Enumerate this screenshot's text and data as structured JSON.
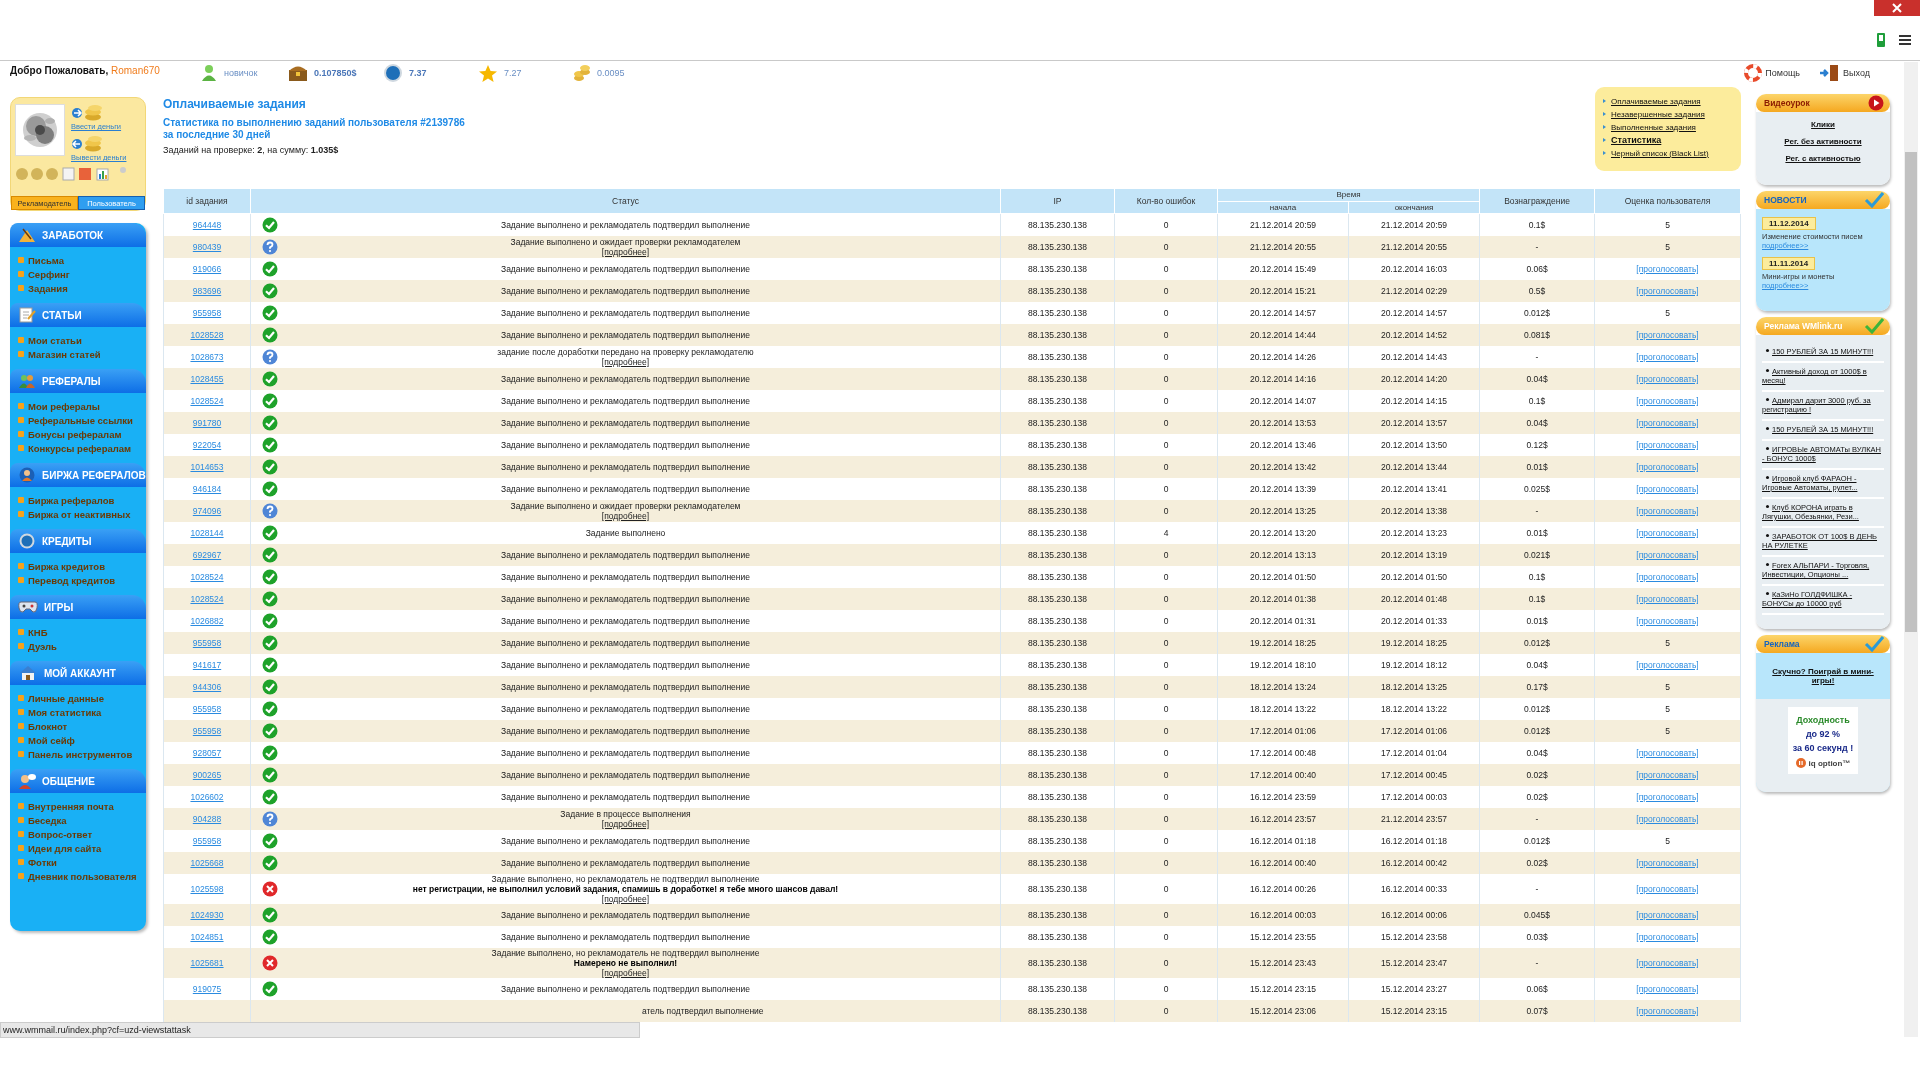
{
  "welcome": {
    "label": "Добро Пожаловать,",
    "user": "Roman670"
  },
  "stats": [
    {
      "kind": "rank",
      "value": "новичок"
    },
    {
      "kind": "balance",
      "value": "0.107850$"
    },
    {
      "kind": "credits",
      "value": "7.37"
    },
    {
      "kind": "rating",
      "value": "7.27"
    },
    {
      "kind": "coins",
      "value": "0.0095"
    }
  ],
  "profile": {
    "links": [
      "Ввести деньги",
      "Вывести деньги"
    ],
    "tabs": [
      {
        "label": "Рекламодатель",
        "selected": false
      },
      {
        "label": "Пользователь",
        "selected": true
      }
    ]
  },
  "menu": [
    {
      "kind": "earn",
      "title": "ЗАРАБОТОК",
      "items": [
        "Письма",
        "Серфинг",
        "Задания"
      ]
    },
    {
      "kind": "articles",
      "title": "СТАТЬИ",
      "items": [
        "Мои статьи",
        "Магазин статей"
      ]
    },
    {
      "kind": "referrals",
      "title": "РЕФЕРАЛЫ",
      "items": [
        "Мои рефералы",
        "Реферальные ссылки",
        "Бонусы рефералам",
        "Конкурсы рефералам"
      ]
    },
    {
      "kind": "exchange",
      "title": "БИРЖА РЕФЕРАЛОВ",
      "items": [
        "Биржа рефералов",
        "Биржа от неактивных"
      ]
    },
    {
      "kind": "credits",
      "title": "КРЕДИТЫ",
      "items": [
        "Биржа кредитов",
        "Перевод кредитов"
      ]
    },
    {
      "kind": "games",
      "title": "ИГРЫ",
      "items": [
        "КНБ",
        "Дуэль"
      ]
    },
    {
      "kind": "account",
      "title": "МОЙ АККАУНТ",
      "items": [
        "Личные данные",
        "Моя статистика",
        "Блокнот",
        "Мой сейф",
        "Панель инструментов"
      ]
    },
    {
      "kind": "chat",
      "title": "ОБЩЕНИЕ",
      "items": [
        "Внутренняя почта",
        "Беседка",
        "Вопрос-ответ",
        "Идеи для сайта",
        "Фотки",
        "Дневник пользователя"
      ]
    }
  ],
  "page": {
    "title": "Оплачиваемые задания",
    "subtitle": [
      "Статистика по выполнению заданий пользователя #2139786",
      "за последние 30 дней"
    ],
    "summary": "Заданий на проверке: **2**, на сумму: **1.035$**"
  },
  "nav": [
    {
      "label": "Оплачиваемые задания",
      "selected": false
    },
    {
      "label": "Незавершенные задания",
      "selected": false
    },
    {
      "label": "Выполненные задания",
      "selected": false
    },
    {
      "label": "Статистика",
      "selected": true
    },
    {
      "label": "Черный список (Black List)",
      "selected": false
    }
  ],
  "table": {
    "columns": {
      "id": "id задания",
      "status": "Статус",
      "ip": "IP",
      "errors": "Кол-во ошибок",
      "time": "Время",
      "start": "начала",
      "end": "окончания",
      "reward": "Вознаграждение",
      "rating": "Оценка пользователя"
    },
    "rows": [
      {
        "id": "964448",
        "kind": "ok",
        "status": "Задание выполнено и рекламодатель подтвердил выполнение",
        "ip": "88.135.230.138",
        "errors": "0",
        "start": "21.12.2014 20:59",
        "end": "21.12.2014 20:59",
        "reward": "0.1$",
        "rating": "5"
      },
      {
        "id": "980439",
        "kind": "pending",
        "status": "Задание выполнено и ожидает проверки рекламодателем",
        "more": "[подробнее]",
        "ip": "88.135.230.138",
        "errors": "0",
        "start": "21.12.2014 20:55",
        "end": "21.12.2014 20:55",
        "reward": "-",
        "rating": "5"
      },
      {
        "id": "919066",
        "kind": "ok",
        "status": "Задание выполнено и рекламодатель подтвердил выполнение",
        "ip": "88.135.230.138",
        "errors": "0",
        "start": "20.12.2014 15:49",
        "end": "20.12.2014 16:03",
        "reward": "0.06$",
        "vote": "[проголосовать]"
      },
      {
        "id": "983696",
        "kind": "ok",
        "status": "Задание выполнено и рекламодатель подтвердил выполнение",
        "ip": "88.135.230.138",
        "errors": "0",
        "start": "20.12.2014 15:21",
        "end": "21.12.2014 02:29",
        "reward": "0.5$",
        "vote": "[проголосовать]"
      },
      {
        "id": "955958",
        "kind": "ok",
        "status": "Задание выполнено и рекламодатель подтвердил выполнение",
        "ip": "88.135.230.138",
        "errors": "0",
        "start": "20.12.2014 14:57",
        "end": "20.12.2014 14:57",
        "reward": "0.012$",
        "rating": "5"
      },
      {
        "id": "1028528",
        "kind": "ok",
        "status": "Задание выполнено и рекламодатель подтвердил выполнение",
        "ip": "88.135.230.138",
        "errors": "0",
        "start": "20.12.2014 14:44",
        "end": "20.12.2014 14:52",
        "reward": "0.081$",
        "vote": "[проголосовать]"
      },
      {
        "id": "1028673",
        "kind": "pending",
        "status": "задание после доработки передано на проверку рекламодателю",
        "more": "[подробнее]",
        "ip": "88.135.230.138",
        "errors": "0",
        "start": "20.12.2014 14:26",
        "end": "20.12.2014 14:43",
        "reward": "-",
        "vote": "[проголосовать]"
      },
      {
        "id": "1028455",
        "kind": "ok",
        "status": "Задание выполнено и рекламодатель подтвердил выполнение",
        "ip": "88.135.230.138",
        "errors": "0",
        "start": "20.12.2014 14:16",
        "end": "20.12.2014 14:20",
        "reward": "0.04$",
        "vote": "[проголосовать]"
      },
      {
        "id": "1028524",
        "kind": "ok",
        "status": "Задание выполнено и рекламодатель подтвердил выполнение",
        "ip": "88.135.230.138",
        "errors": "0",
        "start": "20.12.2014 14:07",
        "end": "20.12.2014 14:15",
        "reward": "0.1$",
        "vote": "[проголосовать]"
      },
      {
        "id": "991780",
        "kind": "ok",
        "status": "Задание выполнено и рекламодатель подтвердил выполнение",
        "ip": "88.135.230.138",
        "errors": "0",
        "start": "20.12.2014 13:53",
        "end": "20.12.2014 13:57",
        "reward": "0.04$",
        "vote": "[проголосовать]"
      },
      {
        "id": "922054",
        "kind": "ok",
        "status": "Задание выполнено и рекламодатель подтвердил выполнение",
        "ip": "88.135.230.138",
        "errors": "0",
        "start": "20.12.2014 13:46",
        "end": "20.12.2014 13:50",
        "reward": "0.12$",
        "vote": "[проголосовать]"
      },
      {
        "id": "1014653",
        "kind": "ok",
        "status": "Задание выполнено и рекламодатель подтвердил выполнение",
        "ip": "88.135.230.138",
        "errors": "0",
        "start": "20.12.2014 13:42",
        "end": "20.12.2014 13:44",
        "reward": "0.01$",
        "vote": "[проголосовать]"
      },
      {
        "id": "946184",
        "kind": "ok",
        "status": "Задание выполнено и рекламодатель подтвердил выполнение",
        "ip": "88.135.230.138",
        "errors": "0",
        "start": "20.12.2014 13:39",
        "end": "20.12.2014 13:41",
        "reward": "0.025$",
        "vote": "[проголосовать]"
      },
      {
        "id": "974096",
        "kind": "pending",
        "status": "Задание выполнено и ожидает проверки рекламодателем",
        "more": "[подробнее]",
        "ip": "88.135.230.138",
        "errors": "0",
        "start": "20.12.2014 13:25",
        "end": "20.12.2014 13:38",
        "reward": "-",
        "vote": "[проголосовать]"
      },
      {
        "id": "1028144",
        "kind": "ok",
        "status": "Задание выполнено",
        "ip": "88.135.230.138",
        "errors": "4",
        "start": "20.12.2014 13:20",
        "end": "20.12.2014 13:23",
        "reward": "0.01$",
        "vote": "[проголосовать]"
      },
      {
        "id": "692967",
        "kind": "ok",
        "status": "Задание выполнено и рекламодатель подтвердил выполнение",
        "ip": "88.135.230.138",
        "errors": "0",
        "start": "20.12.2014 13:13",
        "end": "20.12.2014 13:19",
        "reward": "0.021$",
        "vote": "[проголосовать]"
      },
      {
        "id": "1028524",
        "kind": "ok",
        "status": "Задание выполнено и рекламодатель подтвердил выполнение",
        "ip": "88.135.230.138",
        "errors": "0",
        "start": "20.12.2014 01:50",
        "end": "20.12.2014 01:50",
        "reward": "0.1$",
        "vote": "[проголосовать]"
      },
      {
        "id": "1028524",
        "kind": "ok",
        "status": "Задание выполнено и рекламодатель подтвердил выполнение",
        "ip": "88.135.230.138",
        "errors": "0",
        "start": "20.12.2014 01:38",
        "end": "20.12.2014 01:48",
        "reward": "0.1$",
        "vote": "[проголосовать]"
      },
      {
        "id": "1026882",
        "kind": "ok",
        "status": "Задание выполнено и рекламодатель подтвердил выполнение",
        "ip": "88.135.230.138",
        "errors": "0",
        "start": "20.12.2014 01:31",
        "end": "20.12.2014 01:33",
        "reward": "0.01$",
        "vote": "[проголосовать]"
      },
      {
        "id": "955958",
        "kind": "ok",
        "status": "Задание выполнено и рекламодатель подтвердил выполнение",
        "ip": "88.135.230.138",
        "errors": "0",
        "start": "19.12.2014 18:25",
        "end": "19.12.2014 18:25",
        "reward": "0.012$",
        "rating": "5"
      },
      {
        "id": "941617",
        "kind": "ok",
        "status": "Задание выполнено и рекламодатель подтвердил выполнение",
        "ip": "88.135.230.138",
        "errors": "0",
        "start": "19.12.2014 18:10",
        "end": "19.12.2014 18:12",
        "reward": "0.04$",
        "vote": "[проголосовать]"
      },
      {
        "id": "944306",
        "kind": "ok",
        "status": "Задание выполнено и рекламодатель подтвердил выполнение",
        "ip": "88.135.230.138",
        "errors": "0",
        "start": "18.12.2014 13:24",
        "end": "18.12.2014 13:25",
        "reward": "0.17$",
        "rating": "5"
      },
      {
        "id": "955958",
        "kind": "ok",
        "status": "Задание выполнено и рекламодатель подтвердил выполнение",
        "ip": "88.135.230.138",
        "errors": "0",
        "start": "18.12.2014 13:22",
        "end": "18.12.2014 13:22",
        "reward": "0.012$",
        "rating": "5"
      },
      {
        "id": "955958",
        "kind": "ok",
        "status": "Задание выполнено и рекламодатель подтвердил выполнение",
        "ip": "88.135.230.138",
        "errors": "0",
        "start": "17.12.2014 01:06",
        "end": "17.12.2014 01:06",
        "reward": "0.012$",
        "rating": "5"
      },
      {
        "id": "928057",
        "kind": "ok",
        "status": "Задание выполнено и рекламодатель подтвердил выполнение",
        "ip": "88.135.230.138",
        "errors": "0",
        "start": "17.12.2014 00:48",
        "end": "17.12.2014 01:04",
        "reward": "0.04$",
        "vote": "[проголосовать]"
      },
      {
        "id": "900265",
        "kind": "ok",
        "status": "Задание выполнено и рекламодатель подтвердил выполнение",
        "ip": "88.135.230.138",
        "errors": "0",
        "start": "17.12.2014 00:40",
        "end": "17.12.2014 00:45",
        "reward": "0.02$",
        "vote": "[проголосовать]"
      },
      {
        "id": "1026602",
        "kind": "ok",
        "status": "Задание выполнено и рекламодатель подтвердил выполнение",
        "ip": "88.135.230.138",
        "errors": "0",
        "start": "16.12.2014 23:59",
        "end": "17.12.2014 00:03",
        "reward": "0.02$",
        "vote": "[проголосовать]"
      },
      {
        "id": "904288",
        "kind": "pending",
        "status": "Задание в процессе выполнения",
        "more": "[подробнее]",
        "ip": "88.135.230.138",
        "errors": "0",
        "start": "16.12.2014 23:57",
        "end": "21.12.2014 23:57",
        "reward": "-",
        "vote": "[проголосовать]"
      },
      {
        "id": "955958",
        "kind": "ok",
        "status": "Задание выполнено и рекламодатель подтвердил выполнение",
        "ip": "88.135.230.138",
        "errors": "0",
        "start": "16.12.2014 01:18",
        "end": "16.12.2014 01:18",
        "reward": "0.012$",
        "rating": "5"
      },
      {
        "id": "1025668",
        "kind": "ok",
        "status": "Задание выполнено и рекламодатель подтвердил выполнение",
        "ip": "88.135.230.138",
        "errors": "0",
        "start": "16.12.2014 00:40",
        "end": "16.12.2014 00:42",
        "reward": "0.02$",
        "vote": "[проголосовать]"
      },
      {
        "id": "1025598",
        "kind": "fail",
        "status": "Задание выполнено, но рекламодатель не подтвердил выполнение",
        "note": "нет регистрации, не выполнил условий задания, спамишь в доработке! я тебе много шансов давал!",
        "more": "[подробнее]",
        "ip": "88.135.230.138",
        "errors": "0",
        "start": "16.12.2014 00:26",
        "end": "16.12.2014 00:33",
        "reward": "-",
        "vote": "[проголосовать]"
      },
      {
        "id": "1024930",
        "kind": "ok",
        "status": "Задание выполнено и рекламодатель подтвердил выполнение",
        "ip": "88.135.230.138",
        "errors": "0",
        "start": "16.12.2014 00:03",
        "end": "16.12.2014 00:06",
        "reward": "0.045$",
        "vote": "[проголосовать]"
      },
      {
        "id": "1024851",
        "kind": "ok",
        "status": "Задание выполнено и рекламодатель подтвердил выполнение",
        "ip": "88.135.230.138",
        "errors": "0",
        "start": "15.12.2014 23:55",
        "end": "15.12.2014 23:58",
        "reward": "0.03$",
        "vote": "[проголосовать]"
      },
      {
        "id": "1025681",
        "kind": "fail",
        "status": "Задание выполнено, но рекламодатель не подтвердил выполнение",
        "note": "Намерено не выполнил!",
        "more": "[подробнее]",
        "ip": "88.135.230.138",
        "errors": "0",
        "start": "15.12.2014 23:43",
        "end": "15.12.2014 23:47",
        "reward": "-",
        "vote": "[проголосовать]"
      },
      {
        "id": "919075",
        "kind": "ok",
        "status": "Задание выполнено и рекламодатель подтвердил выполнение",
        "ip": "88.135.230.138",
        "errors": "0",
        "start": "15.12.2014 23:15",
        "end": "15.12.2014 23:27",
        "reward": "0.06$",
        "vote": "[проголосовать]"
      },
      {
        "status": "атель подтвердил выполнение",
        "ip": "88.135.230.138",
        "errors": "0",
        "start": "15.12.2014 23:06",
        "end": "15.12.2014 23:15",
        "reward": "0.07$",
        "vote": "[проголосовать]"
      }
    ]
  },
  "status_bar": "www.wmmail.ru/index.php?cf=uzd-viewstattask",
  "account": {
    "help": "Помощь",
    "logout": "Выход"
  },
  "boxes": [
    {
      "kind": "video",
      "title": "Видеоурок",
      "links": [
        "Клики",
        "Рег. без активности",
        "Рег. с активностью"
      ]
    },
    {
      "kind": "news",
      "title": "НОВОСТИ",
      "items": [
        {
          "date": "11.12.2014",
          "text": "Изменение стоимости писем",
          "link": "подробнее>>"
        },
        {
          "date": "11.11.2014",
          "text": "Мини-игры и монеты",
          "link": "подробнее>>"
        }
      ]
    },
    {
      "kind": "ads",
      "title": "Реклама WMlink.ru",
      "links": [
        "150 РУБЛЕЙ ЗА 15 МИНУТ!!!",
        "Активный доход от 1000$ в месяц!",
        "Адмирал дарит 3000 руб. за регистрацию !",
        "150 РУБЛЕЙ ЗА 15 МИНУТ!!!",
        "ИГРОВЫе АВТОМАТы ВУЛКАН - БОНУС 1000$",
        "Игровой клуб ФАРАОН - Игровые Автоматы, рулет...",
        "Клуб КОРОНА играть в Лягушки, Обезьянки, Рези...",
        "ЗАРАБОТОК ОТ 100$ В ДЕНЬ НА РУЛЕТКЕ",
        "Forex АЛЬПАРИ - Торговля, Инвестиции, Опционы ...",
        "КаЗиНо ГОЛДФИШКА - БОНУСы до 10000 руб"
      ]
    },
    {
      "kind": "promo",
      "title": "Реклама",
      "link": "Скучно? Поиграй в мини-игры!",
      "banner": [
        "Доходность",
        "до 92 %",
        "за 60 секунд !"
      ],
      "brand": "iq option™"
    }
  ]
}
